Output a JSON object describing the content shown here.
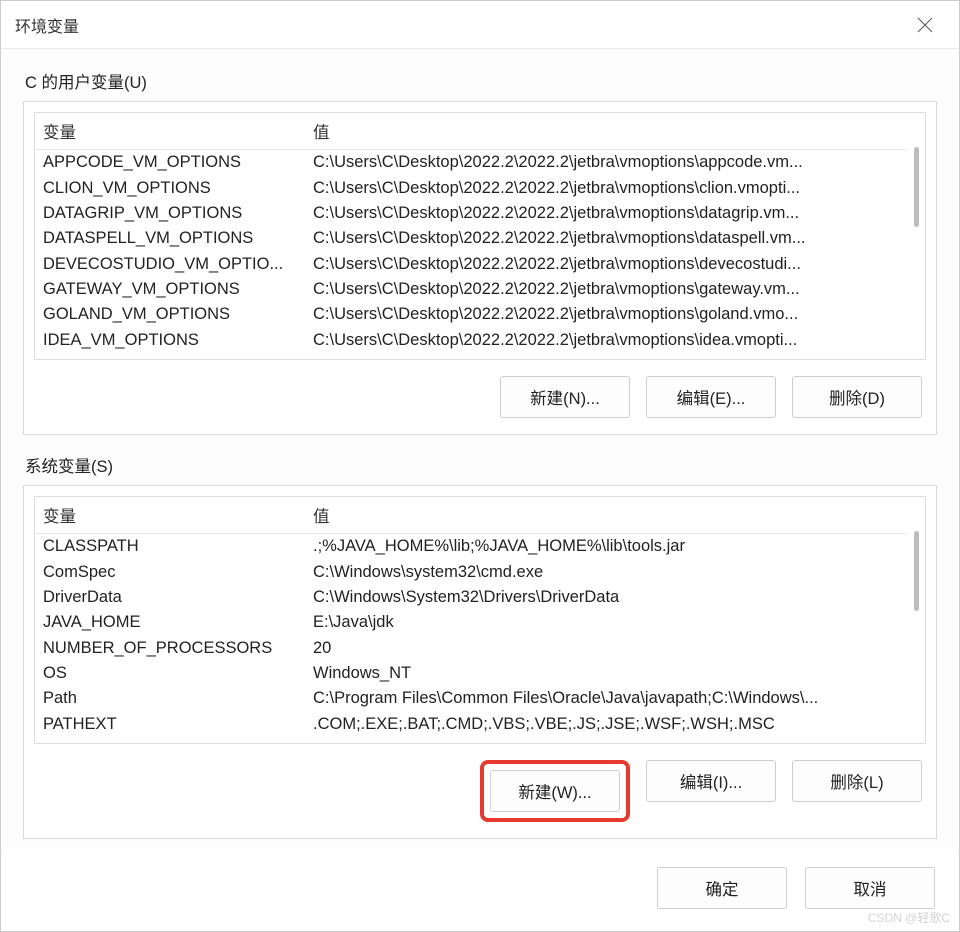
{
  "dialog": {
    "title": "环境变量"
  },
  "user_section": {
    "label": "C 的用户变量(U)",
    "col_var": "变量",
    "col_val": "值",
    "rows": [
      {
        "var": "APPCODE_VM_OPTIONS",
        "val": "C:\\Users\\C\\Desktop\\2022.2\\2022.2\\jetbra\\vmoptions\\appcode.vm..."
      },
      {
        "var": "CLION_VM_OPTIONS",
        "val": "C:\\Users\\C\\Desktop\\2022.2\\2022.2\\jetbra\\vmoptions\\clion.vmopti..."
      },
      {
        "var": "DATAGRIP_VM_OPTIONS",
        "val": "C:\\Users\\C\\Desktop\\2022.2\\2022.2\\jetbra\\vmoptions\\datagrip.vm..."
      },
      {
        "var": "DATASPELL_VM_OPTIONS",
        "val": "C:\\Users\\C\\Desktop\\2022.2\\2022.2\\jetbra\\vmoptions\\dataspell.vm..."
      },
      {
        "var": "DEVECOSTUDIO_VM_OPTIO...",
        "val": "C:\\Users\\C\\Desktop\\2022.2\\2022.2\\jetbra\\vmoptions\\devecostudi..."
      },
      {
        "var": "GATEWAY_VM_OPTIONS",
        "val": "C:\\Users\\C\\Desktop\\2022.2\\2022.2\\jetbra\\vmoptions\\gateway.vm..."
      },
      {
        "var": "GOLAND_VM_OPTIONS",
        "val": "C:\\Users\\C\\Desktop\\2022.2\\2022.2\\jetbra\\vmoptions\\goland.vmo..."
      },
      {
        "var": "IDEA_VM_OPTIONS",
        "val": "C:\\Users\\C\\Desktop\\2022.2\\2022.2\\jetbra\\vmoptions\\idea.vmopti..."
      }
    ],
    "buttons": {
      "new": "新建(N)...",
      "edit": "编辑(E)...",
      "delete": "删除(D)"
    }
  },
  "system_section": {
    "label": "系统变量(S)",
    "col_var": "变量",
    "col_val": "值",
    "rows": [
      {
        "var": "CLASSPATH",
        "val": ".;%JAVA_HOME%\\lib;%JAVA_HOME%\\lib\\tools.jar"
      },
      {
        "var": "ComSpec",
        "val": "C:\\Windows\\system32\\cmd.exe"
      },
      {
        "var": "DriverData",
        "val": "C:\\Windows\\System32\\Drivers\\DriverData"
      },
      {
        "var": "JAVA_HOME",
        "val": "E:\\Java\\jdk"
      },
      {
        "var": "NUMBER_OF_PROCESSORS",
        "val": "20"
      },
      {
        "var": "OS",
        "val": "Windows_NT"
      },
      {
        "var": "Path",
        "val": "C:\\Program Files\\Common Files\\Oracle\\Java\\javapath;C:\\Windows\\..."
      },
      {
        "var": "PATHEXT",
        "val": ".COM;.EXE;.BAT;.CMD;.VBS;.VBE;.JS;.JSE;.WSF;.WSH;.MSC"
      }
    ],
    "buttons": {
      "new": "新建(W)...",
      "edit": "编辑(I)...",
      "delete": "删除(L)"
    }
  },
  "footer": {
    "ok": "确定",
    "cancel": "取消"
  },
  "watermark": "CSDN @轻歌C"
}
